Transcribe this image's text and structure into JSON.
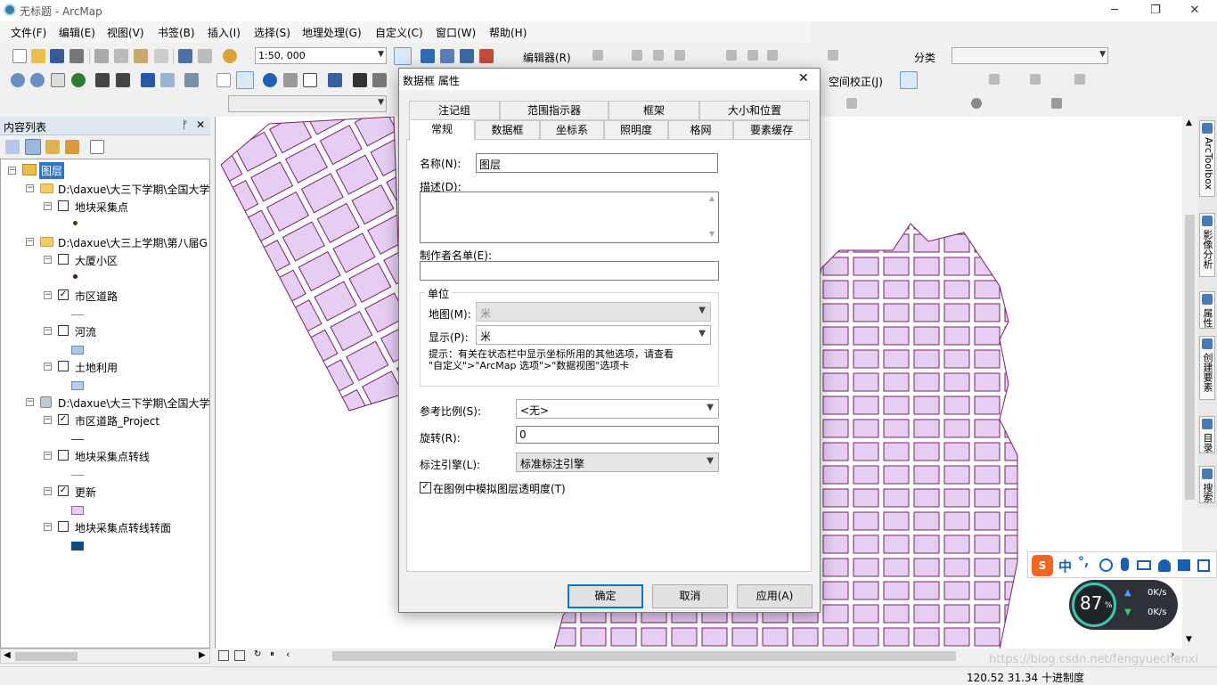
{
  "window": {
    "title": "无标题 - ArcMap",
    "minimize": "─",
    "restore": "❐",
    "close": "✕"
  },
  "menubar": [
    "文件(F)",
    "编辑(E)",
    "视图(V)",
    "书签(B)",
    "插入(I)",
    "选择(S)",
    "地理处理(G)",
    "自定义(C)",
    "窗口(W)",
    "帮助(H)"
  ],
  "toolbar": {
    "scale": "1:50, 000",
    "editor": "编辑器(R)",
    "classify": "分类",
    "georef": "空间校正(J)"
  },
  "toc": {
    "title": "内容列表",
    "pin": "ᚠ",
    "close": "✕",
    "root": "图层",
    "items": [
      {
        "kind": "group",
        "label": "D:\\daxue\\大三下学期\\全国大学"
      },
      {
        "kind": "layer",
        "label": "地块采集点",
        "checked": false
      },
      {
        "kind": "group",
        "label": "D:\\daxue\\大三上学期\\第八届G"
      },
      {
        "kind": "layer",
        "label": "大厦小区",
        "checked": false
      },
      {
        "kind": "layer",
        "label": "市区道路",
        "checked": true
      },
      {
        "kind": "layer",
        "label": "河流",
        "checked": false
      },
      {
        "kind": "layer",
        "label": "土地利用",
        "checked": false
      },
      {
        "kind": "group",
        "label": "D:\\daxue\\大三下学期\\全国大学"
      },
      {
        "kind": "layer",
        "label": "市区道路_Project",
        "checked": true
      },
      {
        "kind": "layer",
        "label": "地块采集点转线",
        "checked": false
      },
      {
        "kind": "layer",
        "label": "更新",
        "checked": true
      },
      {
        "kind": "layer",
        "label": "地块采集点转线转面",
        "checked": false
      }
    ]
  },
  "dock": [
    "ArcToolbox",
    "影像分析",
    "属性",
    "创建要素",
    "目录",
    "搜索"
  ],
  "dialog": {
    "title": "数据框 属性",
    "close": "✕",
    "tabs_top": [
      "注记组",
      "范围指示器",
      "框架",
      "大小和位置"
    ],
    "tabs_bottom": [
      "常规",
      "数据框",
      "坐标系",
      "照明度",
      "格网",
      "要素缓存"
    ],
    "name_label": "名称(N):",
    "name_value": "图层",
    "desc_label": "描述(D):",
    "credits_label": "制作者名单(E):",
    "units_label": "单位",
    "map_label": "地图(M):",
    "map_value": "米",
    "display_label": "显示(P):",
    "display_value": "米",
    "hint": "提示：有关在状态栏中显示坐标所用的其他选项，请查看\n\"自定义\">\"ArcMap 选项\">\"数据视图\"选项卡",
    "refscale_label": "参考比例(S):",
    "refscale_value": "<无>",
    "rotation_label": "旋转(R):",
    "rotation_value": "0",
    "engine_label": "标注引擎(L):",
    "engine_value": "标准标注引擎",
    "simulate_label": "在图例中模拟图层透明度(T)",
    "simulate_checked": true,
    "ok": "确定",
    "cancel": "取消",
    "apply": "应用(A)"
  },
  "ime": {
    "logo": "S",
    "lang": "中",
    "punct": "°,"
  },
  "net": {
    "percent": "87",
    "unit": "%",
    "up": "0K/s",
    "down": "0K/s"
  },
  "status": {
    "coords": "120.52  31.34 十进制度",
    "watermark": "https://blog.csdn.net/fengyuechenxi"
  },
  "colors": {
    "parcel": "#e6cdf2",
    "road": "#7a1f6e",
    "accent": "#0078d7"
  }
}
